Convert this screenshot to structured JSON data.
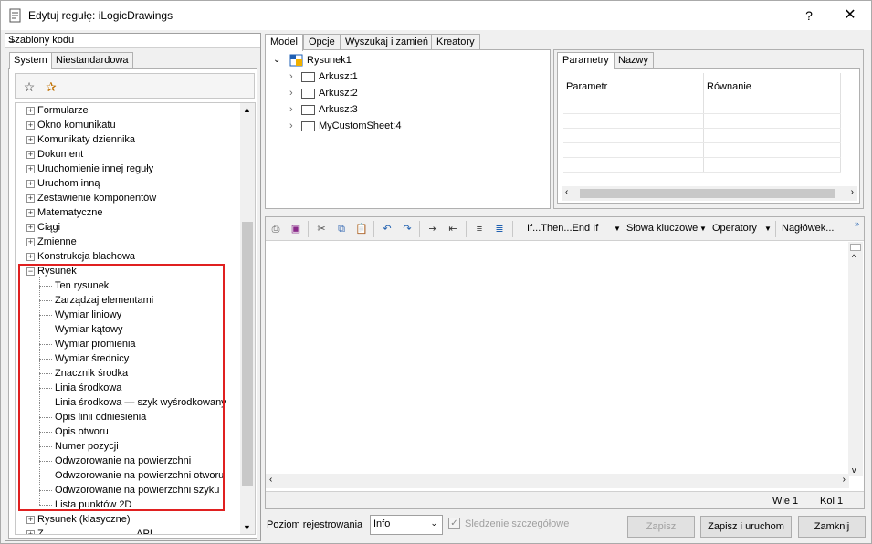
{
  "window": {
    "title": "Edytuj regułę: iLogicDrawings",
    "help_label": "?",
    "close_label": "✕"
  },
  "left_panel": {
    "header": "Szablony kodu",
    "tabs": [
      "System",
      "Niestandardowa"
    ],
    "tree_items": [
      {
        "label": "Formularze",
        "expanded": false
      },
      {
        "label": "Okno komunikatu",
        "expanded": false
      },
      {
        "label": "Komunikaty dziennika",
        "expanded": false
      },
      {
        "label": "Dokument",
        "expanded": false
      },
      {
        "label": "Uruchomienie innej reguły",
        "expanded": false
      },
      {
        "label": "Uruchom inną",
        "expanded": false
      },
      {
        "label": "Zestawienie komponentów",
        "expanded": false
      },
      {
        "label": "Matematyczne",
        "expanded": false
      },
      {
        "label": "Ciągi",
        "expanded": false
      },
      {
        "label": "Zmienne",
        "expanded": false
      },
      {
        "label": "Konstrukcja blachowa",
        "expanded": false
      },
      {
        "label": "Rysunek",
        "expanded": true
      }
    ],
    "rysunek_children": [
      "Ten rysunek",
      "Zarządzaj elementami",
      "Wymiar liniowy",
      "Wymiar kątowy",
      "Wymiar promienia",
      "Wymiar średnicy",
      "Znacznik środka",
      "Linia środkowa",
      "Linia środkowa — szyk wyśrodkowany",
      "Opis linii odniesienia",
      "Opis otworu",
      "Numer pozycji",
      "Odwzorowanie na powierzchni",
      "Odwzorowanie na powierzchni otworu",
      "Odwzorowanie na powierzchni szyku",
      "Lista punktów 2D"
    ],
    "after_items": [
      "Rysunek (klasyczne)",
      "Z……………………… API"
    ]
  },
  "model_tabs": [
    "Model",
    "Opcje",
    "Wyszukaj i zamień",
    "Kreatory"
  ],
  "model_tree": {
    "root": "Rysunek1",
    "sheets": [
      "Arkusz:1",
      "Arkusz:2",
      "Arkusz:3",
      "MyCustomSheet:4"
    ]
  },
  "param_tabs": [
    "Parametry",
    "Nazwy"
  ],
  "param_columns": [
    "Parametr",
    "Równanie"
  ],
  "editor_toolbar": {
    "if_then": "If...Then...End If",
    "keywords": "Słowa kluczowe",
    "operators": "Operatory",
    "headers": "Nagłówek..."
  },
  "editor_status": {
    "line": "Wie 1",
    "col": "Kol 1"
  },
  "bottom": {
    "log_level_label": "Poziom rejestrowania",
    "log_level_value": "Info",
    "detailed_tracking": "Śledzenie szczegółowe",
    "save": "Zapisz",
    "save_and_run": "Zapisz i uruchom",
    "close": "Zamknij"
  },
  "colors": {
    "highlight": "#e02020",
    "accent_blue": "#1e5fb4"
  }
}
